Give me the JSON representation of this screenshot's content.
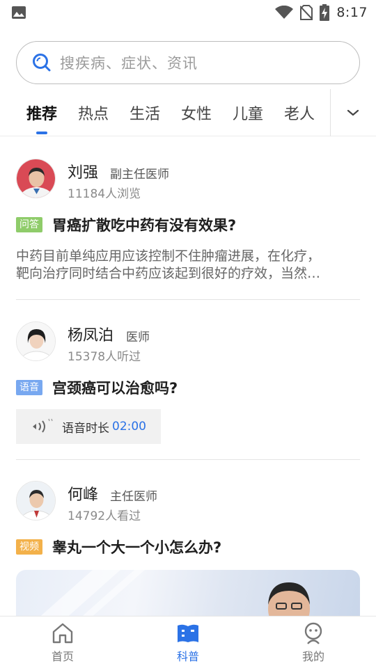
{
  "status_bar": {
    "time": "8:17"
  },
  "search": {
    "placeholder": "搜疾病、症状、资讯"
  },
  "tabs": [
    {
      "label": "推荐",
      "active": true
    },
    {
      "label": "热点"
    },
    {
      "label": "生活"
    },
    {
      "label": "女性"
    },
    {
      "label": "儿童"
    },
    {
      "label": "老人"
    }
  ],
  "posts": [
    {
      "name": "刘强",
      "title": "副主任医师",
      "views": "11184人浏览",
      "badge": "问答",
      "question": "胃癌扩散吃中药有没有效果?",
      "excerpt_line1": "中药目前单纯应用应该控制不住肿瘤进展，在化疗，",
      "excerpt_line2": "靶向治疗同时结合中药应该起到很好的疗效，当然…"
    },
    {
      "name": "杨凤泊",
      "title": "医师",
      "views": "15378人听过",
      "badge": "语音",
      "question": "宫颈癌可以治愈吗?",
      "voice_label": "语音时长",
      "voice_duration": "02:00"
    },
    {
      "name": "何峰",
      "title": "主任医师",
      "views": "14792人看过",
      "badge": "视频",
      "question": "睾丸一个大一个小怎么办?"
    }
  ],
  "bottom_nav": [
    {
      "label": "首页",
      "icon": "home-icon"
    },
    {
      "label": "科普",
      "icon": "book-icon",
      "active": true
    },
    {
      "label": "我的",
      "icon": "profile-icon"
    }
  ],
  "colors": {
    "accent": "#2b72e6",
    "badge_qa": "#8fcc6a",
    "badge_voice": "#78a8f0",
    "badge_video": "#f3b14a"
  }
}
